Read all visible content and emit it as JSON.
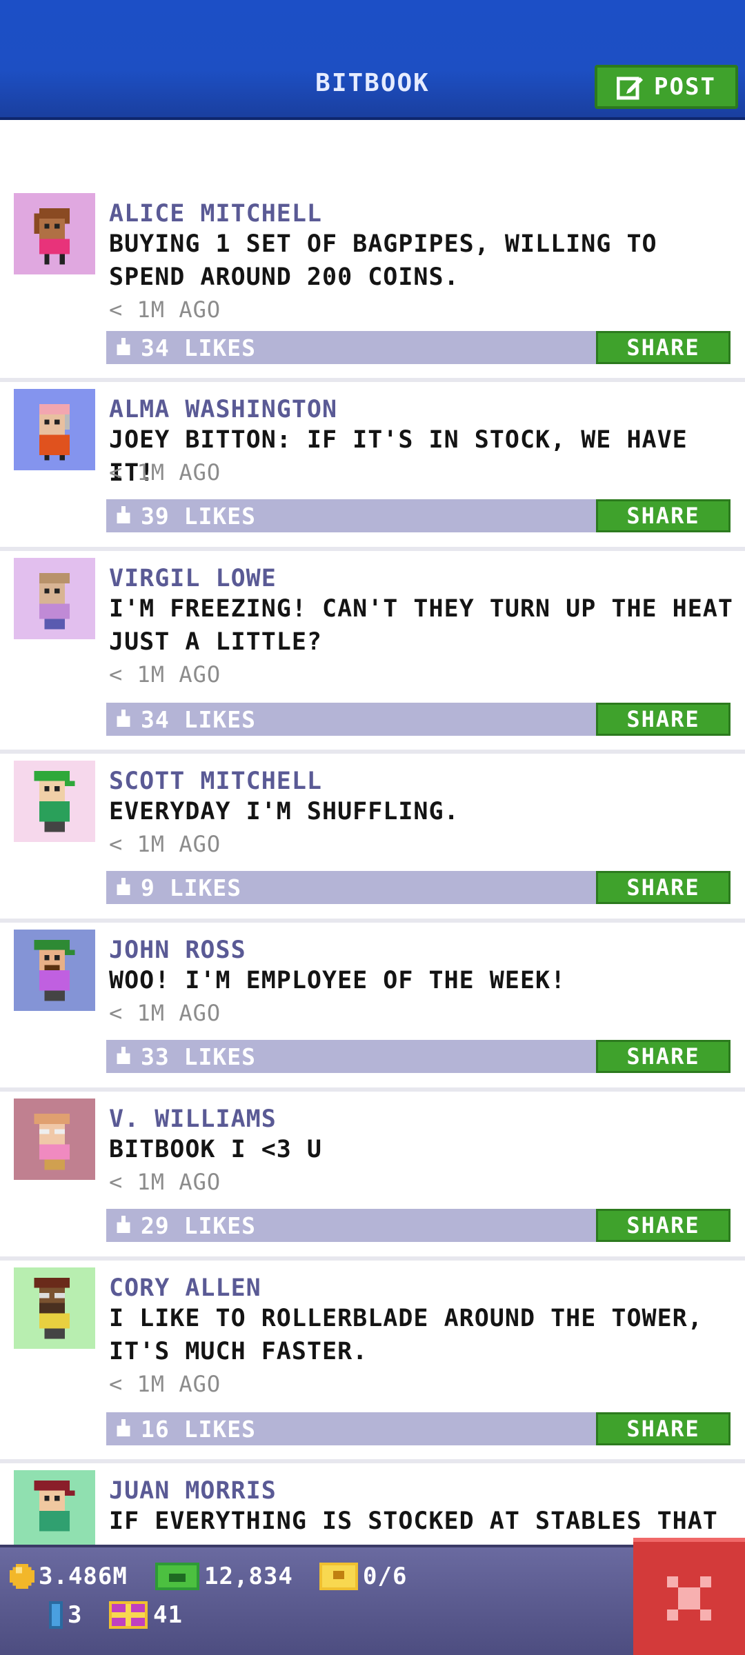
{
  "header": {
    "title": "BITBOOK",
    "post_label": "POST"
  },
  "posts": [
    {
      "name": "ALICE MITCHELL",
      "message": "BUYING 1 SET OF BAGPIPES, WILLING TO SPEND AROUND 200 COINS.",
      "time": "< 1M AGO",
      "likes": "34 LIKES",
      "share": "SHARE"
    },
    {
      "name": "ALMA WASHINGTON",
      "message": "JOEY BITTON: IF IT'S IN STOCK, WE HAVE IT!",
      "time": "< 1M AGO",
      "likes": "39 LIKES",
      "share": "SHARE"
    },
    {
      "name": "VIRGIL LOWE",
      "message": "I'M FREEZING! CAN'T THEY TURN UP THE HEAT JUST A LITTLE?",
      "time": "< 1M AGO",
      "likes": "34 LIKES",
      "share": "SHARE"
    },
    {
      "name": "SCOTT MITCHELL",
      "message": "EVERYDAY I'M SHUFFLING.",
      "time": "< 1M AGO",
      "likes": "9 LIKES",
      "share": "SHARE"
    },
    {
      "name": "JOHN ROSS",
      "message": "WOO! I'M EMPLOYEE OF THE WEEK!",
      "time": "< 1M AGO",
      "likes": "33 LIKES",
      "share": "SHARE"
    },
    {
      "name": "V. WILLIAMS",
      "message": "BITBOOK I <3 U",
      "time": "< 1M AGO",
      "likes": "29 LIKES",
      "share": "SHARE"
    },
    {
      "name": "CORY ALLEN",
      "message": "I LIKE TO ROLLERBLADE AROUND THE TOWER, IT'S MUCH FASTER.",
      "time": "< 1M AGO",
      "likes": "16 LIKES",
      "share": "SHARE"
    },
    {
      "name": "JUAN MORRIS",
      "message": "IF EVERYTHING IS STOCKED AT STABLES THAT",
      "time": "",
      "likes": "",
      "share": ""
    }
  ],
  "status": {
    "coins": "3.486M",
    "bux": "12,834",
    "tickets": "0/6",
    "keys": "3",
    "gifts": "41"
  },
  "colors": {
    "header_blue": "#1c4fc6",
    "accent_green": "#3fa22c",
    "likes_bar": "#b4b4d6",
    "name_color": "#5a5a95",
    "close_red": "#d33a3a"
  },
  "icons": {
    "post": "edit-icon",
    "likes": "thumbs-up-icon",
    "coins": "coin-icon",
    "bux": "bux-icon",
    "tickets": "ticket-icon",
    "keys": "key-icon",
    "gifts": "gift-icon",
    "close": "close-icon"
  }
}
